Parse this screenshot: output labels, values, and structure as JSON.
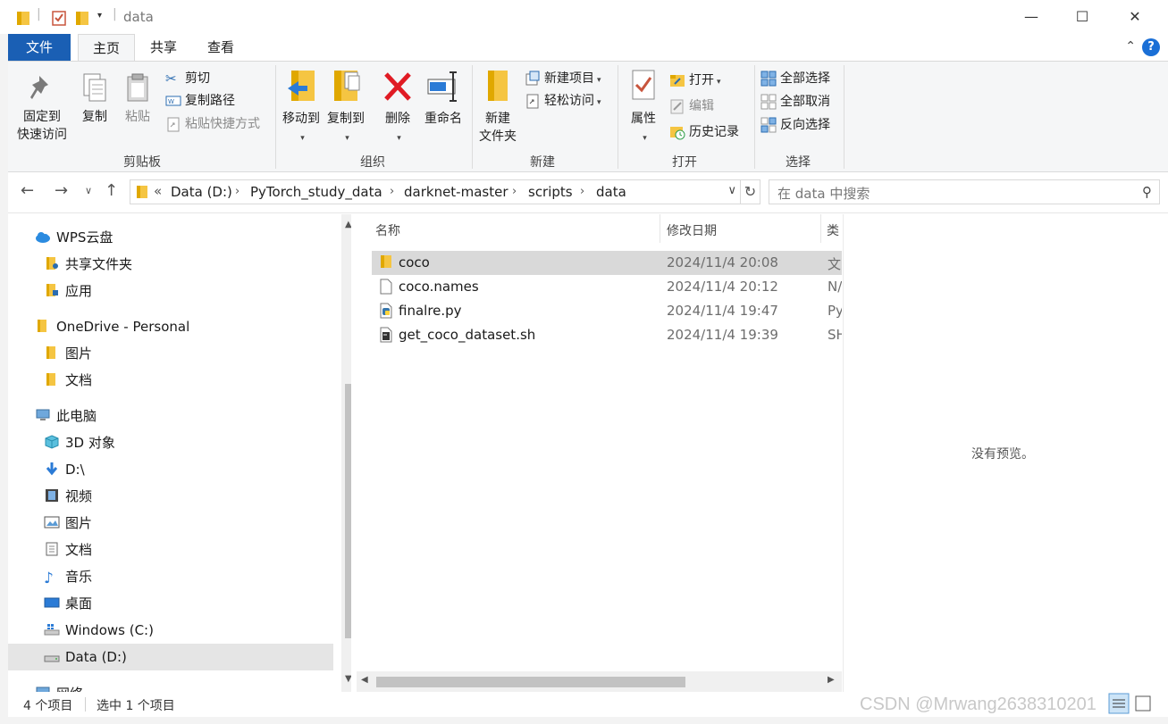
{
  "window": {
    "title": "data",
    "minimize_icon": "minimize-icon",
    "maximize_icon": "maximize-icon",
    "close_icon": "close-icon"
  },
  "tabs": [
    {
      "label": "文件"
    },
    {
      "label": "主页"
    },
    {
      "label": "共享"
    },
    {
      "label": "查看"
    }
  ],
  "ribbon": {
    "clipboard": {
      "label": "剪贴板",
      "pin": "固定到",
      "pin2": "快速访问",
      "copy": "复制",
      "paste": "粘贴",
      "cut": "剪切",
      "copy_path": "复制路径",
      "paste_shortcut": "粘贴快捷方式"
    },
    "organize": {
      "label": "组织",
      "move_to": "移动到",
      "copy_to": "复制到",
      "delete": "删除",
      "rename": "重命名"
    },
    "new": {
      "label": "新建",
      "new_folder": "新建",
      "new_folder2": "文件夹",
      "new_item": "新建项目",
      "easy_access": "轻松访问"
    },
    "open": {
      "label": "打开",
      "properties": "属性",
      "open": "打开",
      "edit": "编辑",
      "history": "历史记录"
    },
    "select": {
      "label": "选择",
      "select_all": "全部选择",
      "select_none": "全部取消",
      "invert": "反向选择"
    }
  },
  "address": {
    "overflow": "«",
    "crumbs": [
      "Data (D:)",
      "PyTorch_study_data",
      "darknet-master",
      "scripts",
      "data"
    ],
    "separator": "›"
  },
  "search": {
    "placeholder": "在 data 中搜索"
  },
  "navpane": {
    "items": [
      {
        "label": "WPS云盘",
        "icon": "cloud-icon"
      },
      {
        "label": "共享文件夹",
        "icon": "shared-folder-icon"
      },
      {
        "label": "应用",
        "icon": "app-folder-icon"
      },
      {
        "label": "OneDrive - Personal",
        "icon": "folder-icon"
      },
      {
        "label": "图片",
        "icon": "folder-icon"
      },
      {
        "label": "文档",
        "icon": "folder-icon"
      },
      {
        "label": "此电脑",
        "icon": "computer-icon"
      },
      {
        "label": "3D 对象",
        "icon": "cube-icon"
      },
      {
        "label": "D:\\",
        "icon": "download-arrow-icon"
      },
      {
        "label": "视频",
        "icon": "film-icon"
      },
      {
        "label": "图片",
        "icon": "picture-icon"
      },
      {
        "label": "文档",
        "icon": "document-icon"
      },
      {
        "label": "音乐",
        "icon": "music-note-icon"
      },
      {
        "label": "桌面",
        "icon": "desktop-icon"
      },
      {
        "label": "Windows (C:)",
        "icon": "windows-drive-icon"
      },
      {
        "label": "Data (D:)",
        "icon": "drive-icon"
      },
      {
        "label": "网络",
        "icon": "network-icon"
      }
    ]
  },
  "filelist": {
    "columns": {
      "name": "名称",
      "date": "修改日期",
      "type": "类"
    },
    "rows": [
      {
        "name": "coco",
        "date": "2024/11/4 20:08",
        "type": "文",
        "icon": "folder-icon"
      },
      {
        "name": "coco.names",
        "date": "2024/11/4 20:12",
        "type": "N/",
        "icon": "file-icon"
      },
      {
        "name": "finalre.py",
        "date": "2024/11/4 19:47",
        "type": "Py",
        "icon": "python-file-icon"
      },
      {
        "name": "get_coco_dataset.sh",
        "date": "2024/11/4 19:39",
        "type": "SH",
        "icon": "shell-script-icon"
      }
    ]
  },
  "preview": {
    "text": "没有预览。"
  },
  "status": {
    "count": "4 个项目",
    "selected": "选中 1 个项目"
  },
  "watermark": "CSDN @Mrwang2638310201",
  "colors": {
    "accent": "#1a5fb4",
    "selection": "#d9d9d9",
    "folder": "#f5c542"
  }
}
